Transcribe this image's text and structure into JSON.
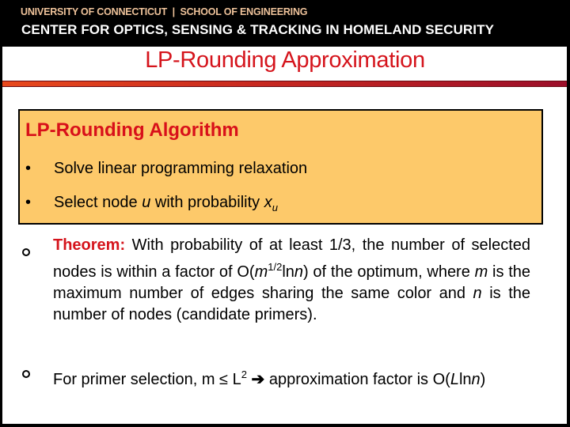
{
  "header": {
    "line1": "UNIVERSITY OF CONNECTICUT  |  SCHOOL OF ENGINEERING",
    "line2": "CENTER FOR OPTICS, SENSING & TRACKING IN HOMELAND SECURITY"
  },
  "slide": {
    "title": "LP-Rounding Approximation",
    "algorithm_box": {
      "heading": "LP-Rounding Algorithm",
      "bullet_glyph": "•",
      "items": [
        {
          "text": "Solve linear programming relaxation"
        },
        {
          "text_before": "Select node ",
          "var": "u",
          "text_after": " with probability ",
          "x": "x",
          "x_sub": "u"
        }
      ]
    },
    "theorem": {
      "label": "Theorem:",
      "parts": {
        "p1": " With probability of at least 1/3, the number of selected nodes is within a factor of O(",
        "m": "m",
        "exp": "1/2",
        "ln": "ln",
        "n": "n",
        "p2": ") of the optimum, where ",
        "m2": "m",
        "p3": " is the maximum number of edges sharing the same color and ",
        "n2": "n",
        "p4": " is the number of nodes (candidate primers)."
      }
    },
    "primer": {
      "p1": "For primer selection, m ≤ L",
      "sup": "2",
      "arrow": " ➔ ",
      "p2": "approximation factor is O(",
      "L": "L",
      "ln": "ln",
      "n": "n",
      "p3": ")"
    },
    "colors": {
      "title": "#d5141c",
      "box_fill": "#fdc96a",
      "header_bg": "#000000",
      "header_line1": "#eec29a"
    }
  }
}
